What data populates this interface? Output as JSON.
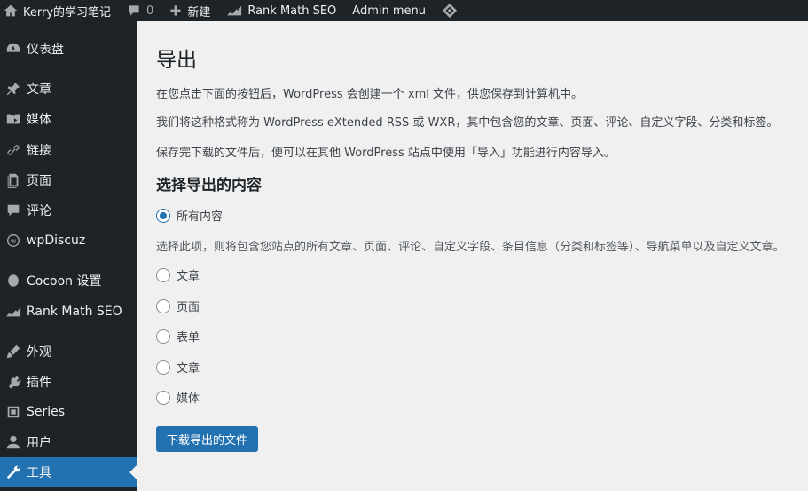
{
  "admin_bar": {
    "site_name": "Kerry的学习笔记",
    "comments_count": "0",
    "new_label": "新建",
    "rank_math_label": "Rank Math SEO",
    "admin_menu_label": "Admin menu"
  },
  "sidebar": {
    "items": [
      {
        "label": "仪表盘",
        "icon": "dashboard-icon"
      },
      {
        "label": "文章",
        "icon": "pin-icon"
      },
      {
        "label": "媒体",
        "icon": "media-icon"
      },
      {
        "label": "链接",
        "icon": "link-icon"
      },
      {
        "label": "页面",
        "icon": "page-icon"
      },
      {
        "label": "评论",
        "icon": "comment-icon"
      },
      {
        "label": "wpDiscuz",
        "icon": "wpdiscuz-icon"
      },
      {
        "label": "Cocoon 设置",
        "icon": "cocoon-icon"
      },
      {
        "label": "Rank Math SEO",
        "icon": "rank-math-icon"
      },
      {
        "label": "外观",
        "icon": "appearance-icon"
      },
      {
        "label": "插件",
        "icon": "plugin-icon"
      },
      {
        "label": "Series",
        "icon": "series-icon"
      },
      {
        "label": "用户",
        "icon": "user-icon"
      },
      {
        "label": "工具",
        "icon": "tools-icon",
        "current": true
      }
    ]
  },
  "page": {
    "title": "导出",
    "intro_1": "在您点击下面的按钮后，WordPress 会创建一个 xml 文件，供您保存到计算机中。",
    "intro_2": "我们将这种格式称为 WordPress eXtended RSS 或 WXR，其中包含您的文章、页面、评论、自定义字段、分类和标签。",
    "intro_3": "保存完下载的文件后，便可以在其他 WordPress 站点中使用「导入」功能进行内容导入。",
    "section_title": "选择导出的内容",
    "all_content_label": "所有内容",
    "all_content_desc": "选择此项，则将包含您站点的所有文章、页面、评论、自定义字段、条目信息（分类和标签等）、导航菜单以及自定义文章。",
    "options": [
      "文章",
      "页面",
      "表单",
      "文章",
      "媒体"
    ],
    "submit_label": "下载导出的文件"
  },
  "colors": {
    "accent": "#2271b1",
    "sidebar_bg": "#1d2327",
    "page_bg": "#f0f0f1"
  }
}
